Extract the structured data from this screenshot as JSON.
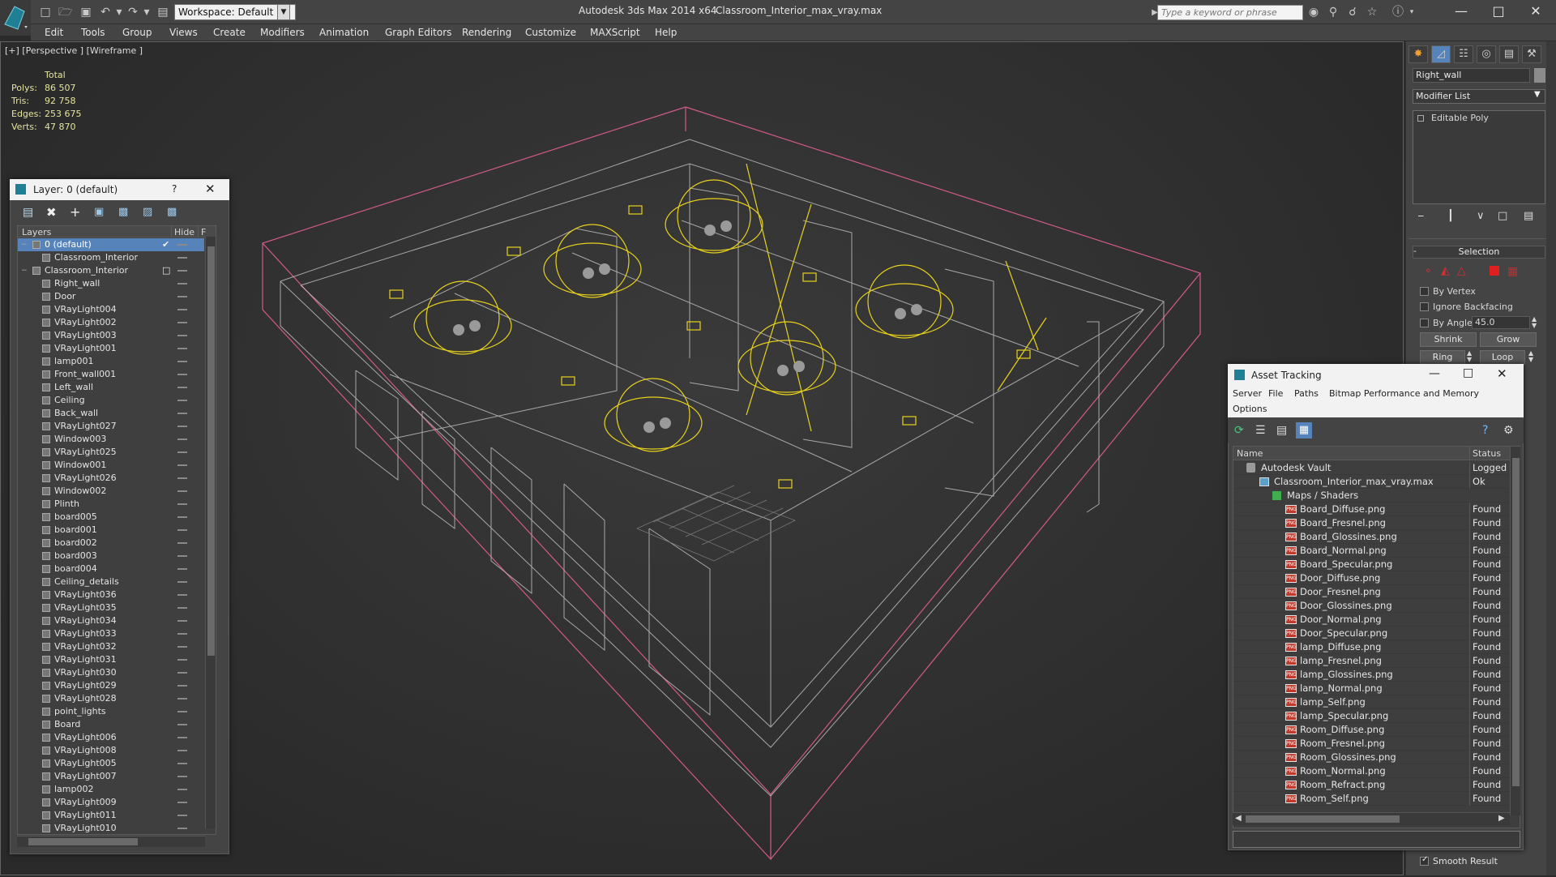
{
  "title_bar": {
    "workspace": "Workspace: Default",
    "app_title": "Autodesk 3ds Max  2014 x64",
    "file_title": "Classroom_Interior_max_vray.max",
    "search_placeholder": "Type a keyword or phrase"
  },
  "menu": [
    "Edit",
    "Tools",
    "Group",
    "Views",
    "Create",
    "Modifiers",
    "Animation",
    "Graph Editors",
    "Rendering",
    "Customize",
    "MAXScript",
    "Help"
  ],
  "viewport": {
    "label": "[+] [Perspective ] [Wireframe ]",
    "stats_header": "Total",
    "stats": [
      {
        "label": "Polys:",
        "value": "86 507"
      },
      {
        "label": "Tris:",
        "value": "92 758"
      },
      {
        "label": "Edges:",
        "value": "253 675"
      },
      {
        "label": "Verts:",
        "value": "47 870"
      }
    ]
  },
  "layer_panel": {
    "title": "Layer: 0 (default)",
    "help": "?",
    "col_layers": "Layers",
    "col_hide": "Hide",
    "col_f": "F",
    "rows": [
      {
        "name": "0 (default)",
        "level": 0,
        "selected": true
      },
      {
        "name": "Classroom_Interior",
        "level": 1
      },
      {
        "name": "Classroom_Interior",
        "level": 0
      },
      {
        "name": "Right_wall",
        "level": 1
      },
      {
        "name": "Door",
        "level": 1
      },
      {
        "name": "VRayLight004",
        "level": 1
      },
      {
        "name": "VRayLight002",
        "level": 1
      },
      {
        "name": "VRayLight003",
        "level": 1
      },
      {
        "name": "VRayLight001",
        "level": 1
      },
      {
        "name": "lamp001",
        "level": 1
      },
      {
        "name": "Front_wall001",
        "level": 1
      },
      {
        "name": "Left_wall",
        "level": 1
      },
      {
        "name": "Ceiling",
        "level": 1
      },
      {
        "name": "Back_wall",
        "level": 1
      },
      {
        "name": "VRayLight027",
        "level": 1
      },
      {
        "name": "Window003",
        "level": 1
      },
      {
        "name": "VRayLight025",
        "level": 1
      },
      {
        "name": "Window001",
        "level": 1
      },
      {
        "name": "VRayLight026",
        "level": 1
      },
      {
        "name": "Window002",
        "level": 1
      },
      {
        "name": "Plinth",
        "level": 1
      },
      {
        "name": "board005",
        "level": 1
      },
      {
        "name": "board001",
        "level": 1
      },
      {
        "name": "board002",
        "level": 1
      },
      {
        "name": "board003",
        "level": 1
      },
      {
        "name": "board004",
        "level": 1
      },
      {
        "name": "Ceiling_details",
        "level": 1
      },
      {
        "name": "VRayLight036",
        "level": 1
      },
      {
        "name": "VRayLight035",
        "level": 1
      },
      {
        "name": "VRayLight034",
        "level": 1
      },
      {
        "name": "VRayLight033",
        "level": 1
      },
      {
        "name": "VRayLight032",
        "level": 1
      },
      {
        "name": "VRayLight031",
        "level": 1
      },
      {
        "name": "VRayLight030",
        "level": 1
      },
      {
        "name": "VRayLight029",
        "level": 1
      },
      {
        "name": "VRayLight028",
        "level": 1
      },
      {
        "name": "point_lights",
        "level": 1
      },
      {
        "name": "Board",
        "level": 1
      },
      {
        "name": "VRayLight006",
        "level": 1
      },
      {
        "name": "VRayLight008",
        "level": 1
      },
      {
        "name": "VRayLight005",
        "level": 1
      },
      {
        "name": "VRayLight007",
        "level": 1
      },
      {
        "name": "lamp002",
        "level": 1
      },
      {
        "name": "VRayLight009",
        "level": 1
      },
      {
        "name": "VRayLight011",
        "level": 1
      },
      {
        "name": "VRayLight010",
        "level": 1
      }
    ]
  },
  "command_panel": {
    "object_name": "Right_wall",
    "modifier_list": "Modifier List",
    "stack_item": "Editable Poly",
    "selection_title": "Selection",
    "by_vertex": "By Vertex",
    "ignore_backfacing": "Ignore Backfacing",
    "by_angle": "By Angle:",
    "angle_value": "45.0",
    "shrink": "Shrink",
    "grow": "Grow",
    "ring": "Ring",
    "loop": "Loop",
    "smooth_result": "Smooth Result"
  },
  "asset_tracking": {
    "title": "Asset Tracking",
    "menu": [
      "Server",
      "File",
      "Paths",
      "Bitmap Performance and Memory"
    ],
    "menu2": "Options",
    "col_name": "Name",
    "col_status": "Status",
    "rows": [
      {
        "name": "Autodesk Vault",
        "status": "Logged O",
        "level": 0,
        "type": "vault"
      },
      {
        "name": "Classroom_Interior_max_vray.max",
        "status": "Ok",
        "level": 1,
        "type": "max"
      },
      {
        "name": "Maps / Shaders",
        "status": "",
        "level": 2,
        "type": "folder"
      },
      {
        "name": "Board_Diffuse.png",
        "status": "Found",
        "level": 3,
        "type": "png"
      },
      {
        "name": "Board_Fresnel.png",
        "status": "Found",
        "level": 3,
        "type": "png"
      },
      {
        "name": "Board_Glossines.png",
        "status": "Found",
        "level": 3,
        "type": "png"
      },
      {
        "name": "Board_Normal.png",
        "status": "Found",
        "level": 3,
        "type": "png"
      },
      {
        "name": "Board_Specular.png",
        "status": "Found",
        "level": 3,
        "type": "png"
      },
      {
        "name": "Door_Diffuse.png",
        "status": "Found",
        "level": 3,
        "type": "png"
      },
      {
        "name": "Door_Fresnel.png",
        "status": "Found",
        "level": 3,
        "type": "png"
      },
      {
        "name": "Door_Glossines.png",
        "status": "Found",
        "level": 3,
        "type": "png"
      },
      {
        "name": "Door_Normal.png",
        "status": "Found",
        "level": 3,
        "type": "png"
      },
      {
        "name": "Door_Specular.png",
        "status": "Found",
        "level": 3,
        "type": "png"
      },
      {
        "name": "lamp_Diffuse.png",
        "status": "Found",
        "level": 3,
        "type": "png"
      },
      {
        "name": "lamp_Fresnel.png",
        "status": "Found",
        "level": 3,
        "type": "png"
      },
      {
        "name": "lamp_Glossines.png",
        "status": "Found",
        "level": 3,
        "type": "png"
      },
      {
        "name": "lamp_Normal.png",
        "status": "Found",
        "level": 3,
        "type": "png"
      },
      {
        "name": "lamp_Self.png",
        "status": "Found",
        "level": 3,
        "type": "png"
      },
      {
        "name": "lamp_Specular.png",
        "status": "Found",
        "level": 3,
        "type": "png"
      },
      {
        "name": "Room_Diffuse.png",
        "status": "Found",
        "level": 3,
        "type": "png"
      },
      {
        "name": "Room_Fresnel.png",
        "status": "Found",
        "level": 3,
        "type": "png"
      },
      {
        "name": "Room_Glossines.png",
        "status": "Found",
        "level": 3,
        "type": "png"
      },
      {
        "name": "Room_Normal.png",
        "status": "Found",
        "level": 3,
        "type": "png"
      },
      {
        "name": "Room_Refract.png",
        "status": "Found",
        "level": 3,
        "type": "png"
      },
      {
        "name": "Room_Self.png",
        "status": "Found",
        "level": 3,
        "type": "png"
      }
    ]
  },
  "colors": {
    "selection": "#5683b9",
    "wire_light": "#e8d21c",
    "bbox": "#d25a8a"
  }
}
